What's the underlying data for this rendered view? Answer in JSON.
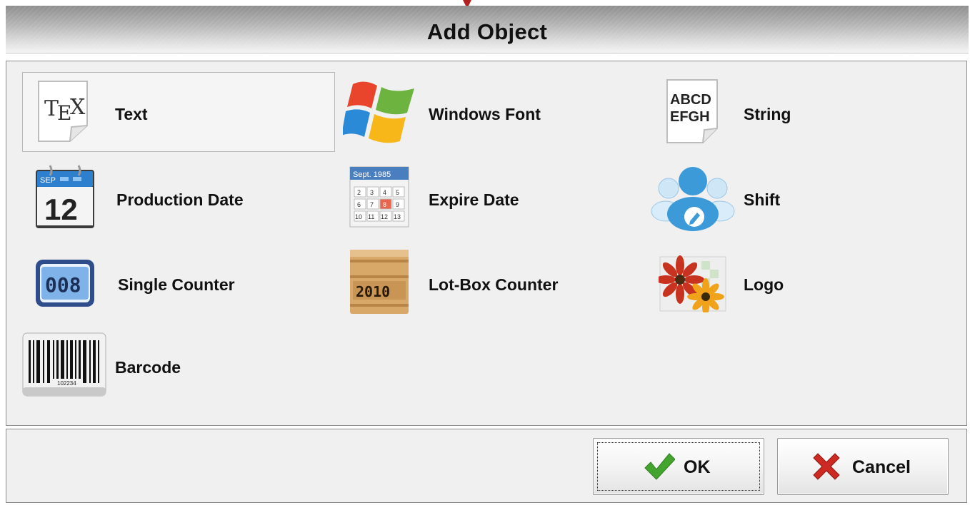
{
  "dialog": {
    "title": "Add Object"
  },
  "objects": [
    {
      "label": "Text",
      "icon": "tex-document-icon",
      "selected": true
    },
    {
      "label": "Windows Font",
      "icon": "windows-logo-icon"
    },
    {
      "label": "String",
      "icon": "abcd-document-icon",
      "icon_text_1": "ABCD",
      "icon_text_2": "EFGH"
    },
    {
      "label": "Production Date",
      "icon": "desk-calendar-icon",
      "icon_month": "SEP",
      "icon_day": "12"
    },
    {
      "label": "Expire Date",
      "icon": "calendar-grid-icon",
      "icon_header": "Sept. 1985"
    },
    {
      "label": "Shift",
      "icon": "users-group-icon"
    },
    {
      "label": "Single Counter",
      "icon": "counter-display-icon",
      "icon_text": "008"
    },
    {
      "label": "Lot-Box Counter",
      "icon": "wooden-box-icon",
      "icon_text": "2010"
    },
    {
      "label": "Logo",
      "icon": "flower-image-icon"
    },
    {
      "label": "Barcode",
      "icon": "barcode-icon",
      "icon_text": "102234"
    }
  ],
  "buttons": {
    "ok_label": "OK",
    "cancel_label": "Cancel"
  },
  "colors": {
    "ok_check": "#43a52e",
    "cancel_x": "#cc2a22",
    "accent_arrow": "#b32020"
  }
}
